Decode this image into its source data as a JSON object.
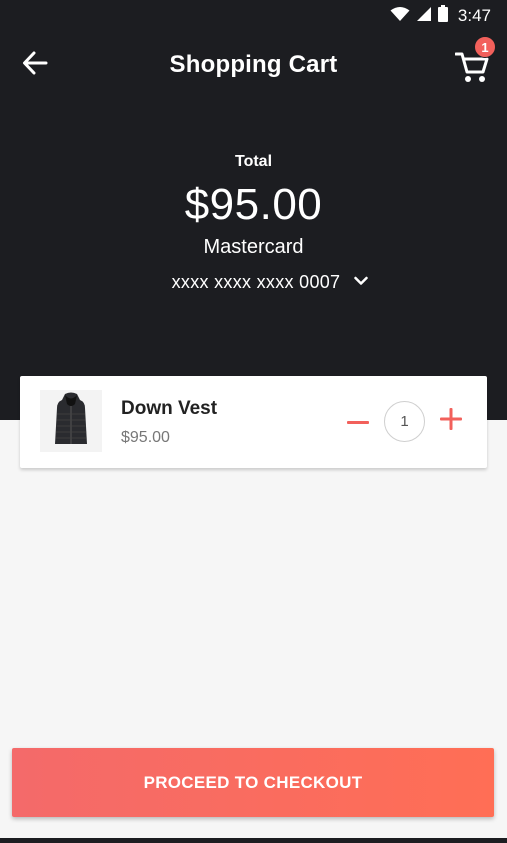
{
  "status_bar": {
    "time": "3:47",
    "icons": [
      "wifi-icon",
      "signal-icon",
      "battery-icon"
    ]
  },
  "toolbar": {
    "title": "Shopping Cart",
    "back_icon": "arrow-left-icon",
    "cart_icon": "cart-icon",
    "cart_badge": "1"
  },
  "summary": {
    "total_label": "Total",
    "total_amount": "$95.00",
    "card_type": "Mastercard",
    "card_number": "xxxx xxxx xxxx 0007",
    "dropdown_icon": "chevron-down-icon"
  },
  "cart_items": [
    {
      "name": "Down Vest",
      "price": "$95.00",
      "quantity": "1",
      "image_icon": "vest-icon"
    }
  ],
  "checkout": {
    "label": "PROCEED TO CHECKOUT"
  },
  "colors": {
    "header_bg": "#1c1d21",
    "accent": "#f2605b",
    "page_bg": "#f6f6f6"
  }
}
